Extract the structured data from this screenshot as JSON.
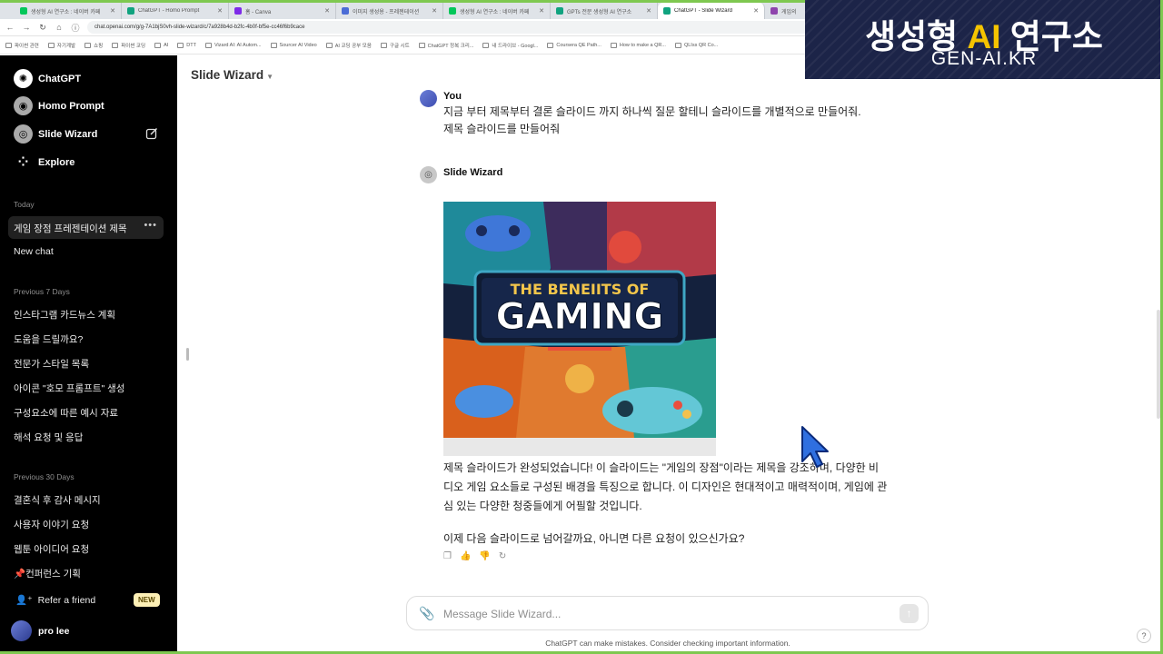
{
  "browser": {
    "tabs": [
      {
        "title": "생성형 AI 연구소 : 네이버 카페",
        "color": "#03c75a"
      },
      {
        "title": "ChatGPT - Homo Prompt",
        "color": "#10a37f"
      },
      {
        "title": "홈 - Canva",
        "color": "#7d2ae8"
      },
      {
        "title": "이미지 생성용 - 프레젠테이션",
        "color": "#4b6cd6"
      },
      {
        "title": "생성형 AI 연구소 : 네이버 카페",
        "color": "#03c75a"
      },
      {
        "title": "GPTs 전문 생성형 AI 연구소",
        "color": "#10a37f"
      },
      {
        "title": "ChatGPT - Slide Wizard",
        "color": "#10a37f"
      },
      {
        "title": "게임의",
        "color": "#8e44ad"
      }
    ],
    "url": "chat.openai.com/g/g-7A1bjS0vh-slide-wizard/c/7a928b4d-b2fc-4b0f-bf5e-cc46f6b9cace",
    "bookmarks": [
      "파이썬 관련",
      "자기계발",
      "쇼핑",
      "파이썬 코딩",
      "AI",
      "DTT",
      "Vizard AI: AI Autom...",
      "Sourcer AI Video",
      "AI 코딩 공부 모음",
      "구글 시트",
      "ChatGPT 정복 크리...",
      "내 드라이브 - Googl...",
      "Coursera QE Path...",
      "How to make a QR...",
      "QLIss QR Co..."
    ]
  },
  "banner": {
    "title_pre": "생성형 ",
    "title_ai": "AI",
    "title_post": " 연구소",
    "subtitle": "GEN-AI.KR"
  },
  "sidebar": {
    "chatgpt": "ChatGPT",
    "homo_prompt": "Homo Prompt",
    "slide_wizard": "Slide Wizard",
    "explore": "Explore",
    "today_label": "Today",
    "today_items": [
      "게임 장점 프레젠테이션 제목",
      "New chat"
    ],
    "prev7_label": "Previous 7 Days",
    "prev7_items": [
      "인스타그램 카드뉴스 계획",
      "도움을 드릴까요?",
      "전문가 스타일 목록",
      "아이콘 \"호모 프롬프트\" 생성",
      "구성요소에 따른 예시 자료",
      "해석 요청 및 응답"
    ],
    "prev30_label": "Previous 30 Days",
    "prev30_items": [
      "결혼식 후 감사 메시지",
      "사용자 이야기 요청",
      "웹툰 아이디어 요청",
      "📌컨퍼런스 기획"
    ],
    "refer": "Refer a friend",
    "new_badge": "NEW",
    "user_name": "pro lee"
  },
  "main": {
    "model_title": "Slide Wizard",
    "user_author": "You",
    "user_line1": "지금 부터 제목부터 결론 슬라이드 까지 하나씩 질문 할테니 슬라이드를 개별적으로 만들어줘.",
    "user_line2": "제목 슬라이드를 만들어줘",
    "bot_author": "Slide Wizard",
    "image_title_small": "THE BENEIITS OF",
    "image_title_big": "GAMING",
    "bot_para1_line1": "제목 슬라이드가 완성되었습니다! 이 슬라이드는 \"게임의 장점\"이라는 제목을 강조하며, 다양한 비",
    "bot_para1_line2": "디오 게임 요소들로 구성된 배경을 특징으로 합니다. 이 디자인은 현대적이고 매력적이며, 게임에 관",
    "bot_para1_line3": "심 있는 다양한 청중들에게 어필할 것입니다.",
    "bot_para2": "이제 다음 슬라이드로 넘어갈까요, 아니면 다른 요청이 있으신가요?",
    "composer_placeholder": "Message Slide Wizard...",
    "disclaimer": "ChatGPT can make mistakes. Consider checking important information.",
    "help": "?"
  }
}
